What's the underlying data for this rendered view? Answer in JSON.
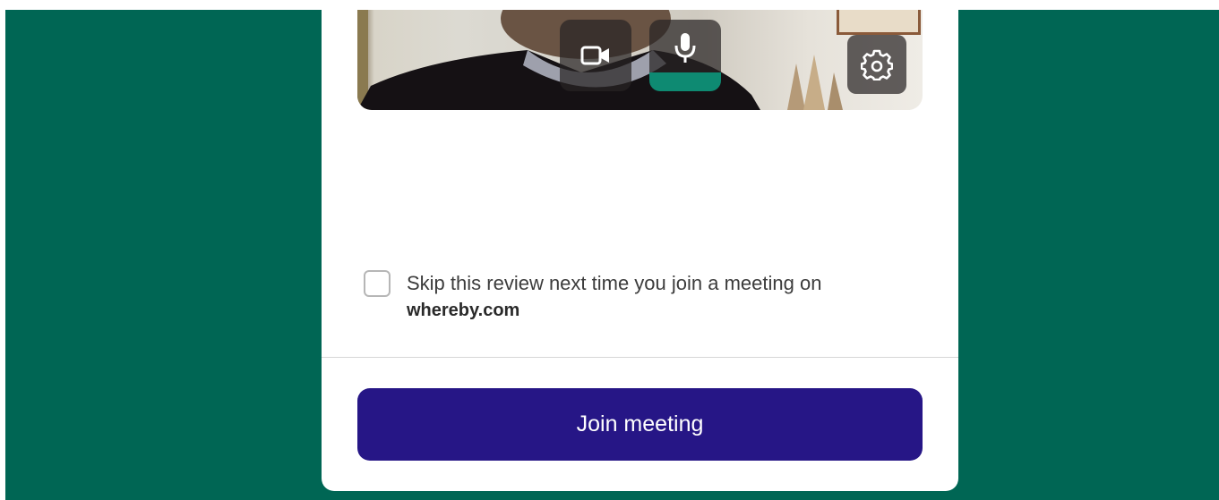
{
  "colors": {
    "page_background": "#006654",
    "card_background": "#ffffff",
    "primary_button": "#261686",
    "mic_level_indicator": "#0e8a72"
  },
  "preview": {
    "camera_button_icon": "video-camera-icon",
    "mic_button_icon": "microphone-icon",
    "settings_button_icon": "gear-icon",
    "mic_level_fraction": 0.26
  },
  "skip_review": {
    "checked": false,
    "label": "Skip this review next time you join a meeting on",
    "domain": "whereby.com"
  },
  "join_button": {
    "label": "Join meeting"
  }
}
